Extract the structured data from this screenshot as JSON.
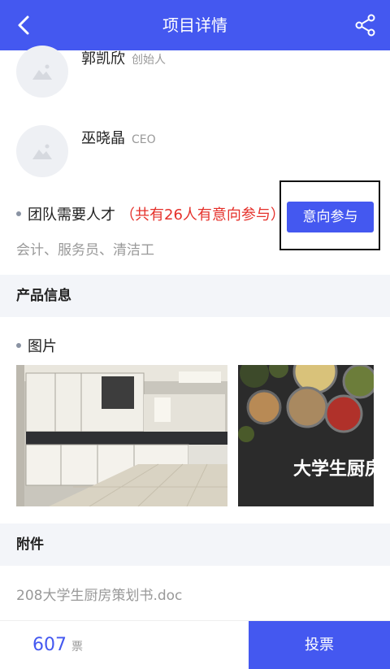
{
  "header": {
    "title": "项目详情",
    "back_icon": "chevron-left-icon",
    "share_icon": "share-icon"
  },
  "team": [
    {
      "name": "郭凯欣",
      "role": "创始人"
    },
    {
      "name": "巫晓晶",
      "role": "CEO"
    }
  ],
  "talent": {
    "label": "团队需要人才",
    "interest_text": "（共有26人有意向参与）",
    "intent_button": "意向参与",
    "roles": "会计、服务员、清洁工"
  },
  "product": {
    "section_title": "产品信息",
    "pictures_label": "图片"
  },
  "attachments": {
    "section_title": "附件",
    "file_name": "208大学生厨房策划书.doc"
  },
  "footer": {
    "vote_count": "607",
    "vote_unit": "票",
    "vote_button": "投票"
  },
  "colors": {
    "primary": "#4458f0",
    "accent_red": "#e5302a",
    "section_bg": "#f3f5f9"
  },
  "images": [
    {
      "alt": "kitchen photo"
    },
    {
      "alt": "food bowls poster",
      "overlay_text": "大学生厨房"
    }
  ]
}
